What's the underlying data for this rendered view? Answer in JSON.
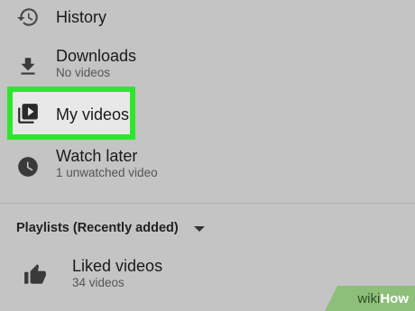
{
  "menu": {
    "history": {
      "label": "History",
      "icon": "history-icon"
    },
    "downloads": {
      "label": "Downloads",
      "subtitle": "No videos",
      "icon": "download-icon"
    },
    "my_videos": {
      "label": "My videos",
      "icon": "my-videos-icon"
    },
    "watch_later": {
      "label": "Watch later",
      "subtitle": "1 unwatched video",
      "icon": "clock-icon"
    }
  },
  "playlists": {
    "header": "Playlists (Recently added)",
    "items": [
      {
        "label": "Liked videos",
        "subtitle": "34 videos",
        "icon": "thumbs-up-icon"
      }
    ]
  },
  "watermark": {
    "part1": "wiki",
    "part2": "How"
  },
  "colors": {
    "highlight": "#2fe62f",
    "background": "#c4c4c4",
    "watermark": "#8dbf7a"
  }
}
